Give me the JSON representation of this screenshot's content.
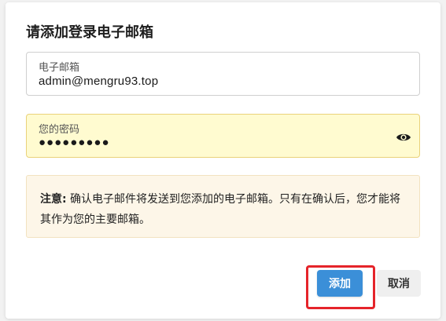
{
  "dialog": {
    "title": "请添加登录电子邮箱",
    "email": {
      "label": "电子邮箱",
      "value": "admin@mengru93.top"
    },
    "password": {
      "label": "您的密码",
      "value": "●●●●●●●●●",
      "icon": "eye-icon"
    },
    "notice": {
      "prefix": "注意:",
      "text": " 确认电子邮件将发送到您添加的电子邮箱。只有在确认后，您才能将其作为您的主要邮箱。"
    },
    "buttons": {
      "add_label": "添加",
      "cancel_label": "取消"
    }
  },
  "colors": {
    "accent": "#3b8fd8",
    "highlight": "#e5242a",
    "password_bg": "#fffbd0",
    "notice_bg": "#fdf6e8"
  }
}
